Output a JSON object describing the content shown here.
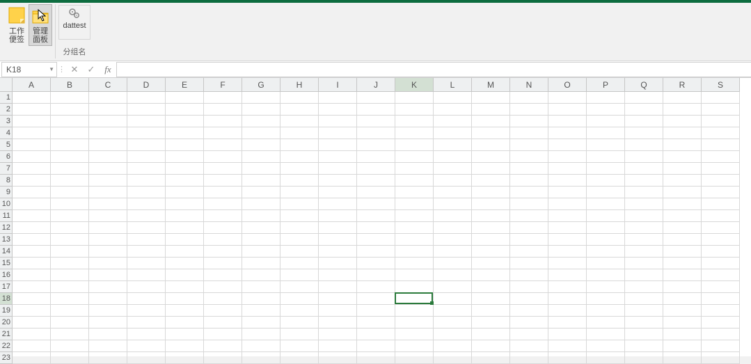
{
  "ribbon": {
    "group1": {
      "btn1": {
        "label": "工作\n便签",
        "icon": "note"
      },
      "btn2": {
        "label": "管理\n面板",
        "icon": "folder"
      }
    },
    "group2": {
      "btn1": {
        "label": "dattest",
        "icon": "gear"
      },
      "group_label": "分组名"
    }
  },
  "formula_bar": {
    "name_box": "K18",
    "cancel": "✕",
    "confirm": "✓",
    "fx": "fx",
    "value": ""
  },
  "grid": {
    "columns": [
      "A",
      "B",
      "C",
      "D",
      "E",
      "F",
      "G",
      "H",
      "I",
      "J",
      "K",
      "L",
      "M",
      "N",
      "O",
      "P",
      "Q",
      "R",
      "S"
    ],
    "rows": [
      "1",
      "2",
      "3",
      "4",
      "5",
      "6",
      "7",
      "8",
      "9",
      "10",
      "11",
      "12",
      "13",
      "14",
      "15",
      "16",
      "17",
      "18",
      "19",
      "20",
      "21",
      "22",
      "23"
    ],
    "selected_col_index": 10,
    "selected_row_index": 17
  }
}
